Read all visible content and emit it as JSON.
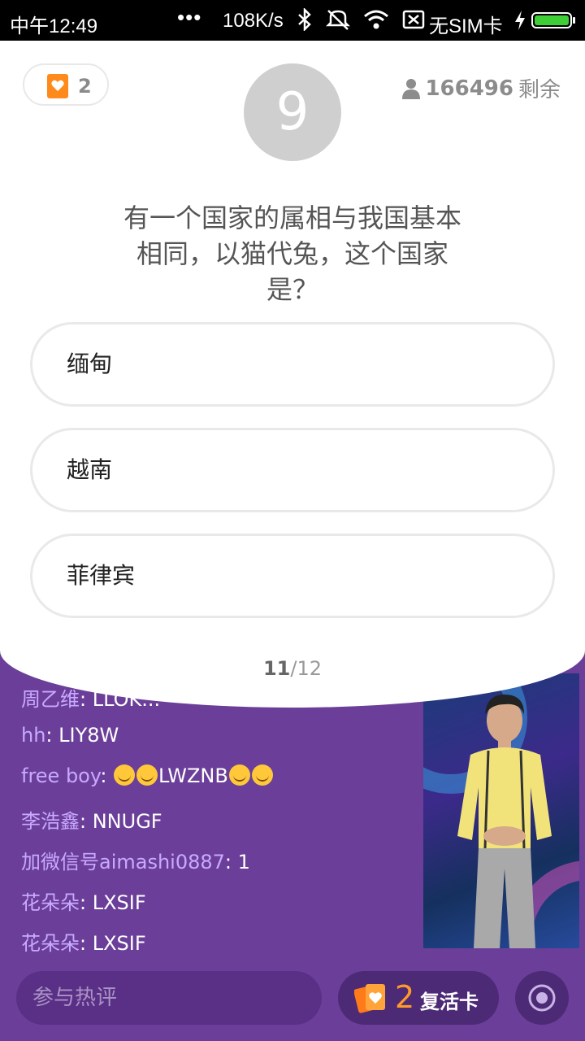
{
  "status_bar": {
    "time": "中午12:49",
    "dots": "•••",
    "speed": "108K/s",
    "carrier": "无SIM卡",
    "icons": [
      "bluetooth-icon",
      "mute-icon",
      "wifi-icon",
      "no-sim-icon",
      "charging-icon",
      "battery-icon"
    ]
  },
  "header": {
    "revive_count": "2",
    "timer": "9",
    "remaining_count": "166496",
    "remaining_label": "剩余"
  },
  "question": {
    "text": "有一个国家的属相与我国基本相同，以猫代兔，这个国家是？"
  },
  "options": [
    {
      "label": "缅甸"
    },
    {
      "label": "越南"
    },
    {
      "label": "菲律宾"
    }
  ],
  "progress": {
    "current": "11",
    "separator": "/",
    "total": "12"
  },
  "chat": [
    {
      "user": "周乙维",
      "message": "LLOK..."
    },
    {
      "user": "hh",
      "message": "LIY8W"
    },
    {
      "user": "free  boy",
      "message_parts": [
        "emoji",
        "emoji",
        "LWZNB",
        "emoji",
        "emoji"
      ],
      "message_text": "LWZNB"
    },
    {
      "user": "李浩鑫",
      "message": "NNUGF"
    },
    {
      "user": "加微信号aimashi0887",
      "message": "1"
    },
    {
      "user": "花朵朵",
      "message": "LXSIF"
    },
    {
      "user": "花朵朵",
      "message": "LXSIF"
    }
  ],
  "bottom_bar": {
    "comment_placeholder": "参与热评",
    "revive_card_count": "2",
    "revive_card_label": "复活卡"
  },
  "colors": {
    "purple_bg": "#6b3f99",
    "orange_accent": "#ff8a1c",
    "chat_user": "#c9a9ff"
  }
}
